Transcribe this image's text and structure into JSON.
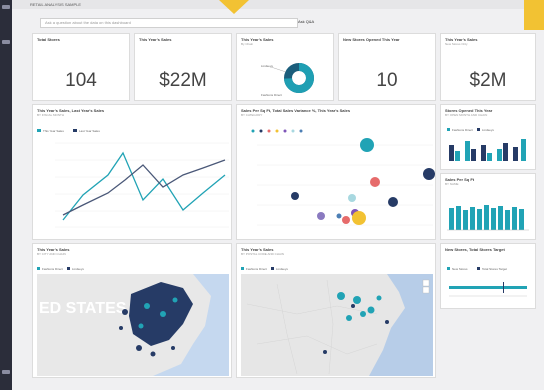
{
  "window_title": "RETAIL ANALYSIS SAMPLE",
  "qna": {
    "placeholder": "Ask a question about the data on this dashboard",
    "button_label": "Ask Q&A"
  },
  "kpi": [
    {
      "title": "Total Stores",
      "value": "104"
    },
    {
      "title": "This Year's Sales",
      "value": "$22M"
    },
    {
      "title": "New Stores Opened This Year",
      "value": "10"
    },
    {
      "title": "This Year's Sales",
      "subtitle": "New Stores Only",
      "value": "$2M"
    }
  ],
  "donut_tile": {
    "title": "This Year's Sales",
    "subtitle": "By Chain",
    "labels": [
      "Fashions Direct",
      "Lindseys"
    ],
    "colors": {
      "primary": "#1f9fb3",
      "secondary": "#1b5e7c"
    }
  },
  "line_tile": {
    "title": "This Year's Sales, Last Year's Sales",
    "subtitle": "BY FISCAL MONTH",
    "legend": [
      "This Year Sales",
      "Last Year Sales"
    ]
  },
  "scatter_tile": {
    "title": "Sales Per Sq Ft, Total Sales Variance %, This Year's Sales",
    "subtitle": "BY CATEGORY"
  },
  "bar1_tile": {
    "title": "Stores Opened This Year",
    "subtitle": "BY OPEN MONTH AND CHAIN",
    "legend": [
      "Fashions Direct",
      "Lindseys"
    ]
  },
  "bar2_tile": {
    "title": "Sales Per Sq Ft",
    "subtitle": "BY NAME"
  },
  "map1_tile": {
    "title": "This Year's Sales",
    "subtitle": "BY CITY AND CHAIN",
    "legend": [
      "Fashions Direct",
      "Lindseys"
    ],
    "map_label": "ED STATES"
  },
  "map2_tile": {
    "title": "This Year's Sales",
    "subtitle": "BY POSTAL CODE AND CHAIN",
    "legend": [
      "Fashions Direct",
      "Lindseys"
    ]
  },
  "gauge_tile": {
    "title": "New Stores, Total Stores Target",
    "legend": [
      "New Stores",
      "Total Stores Target"
    ]
  },
  "colors": {
    "teal": "#21a3b5",
    "navy": "#263b66",
    "accent": "#f2c233",
    "sidebar": "#2b2d3a"
  }
}
